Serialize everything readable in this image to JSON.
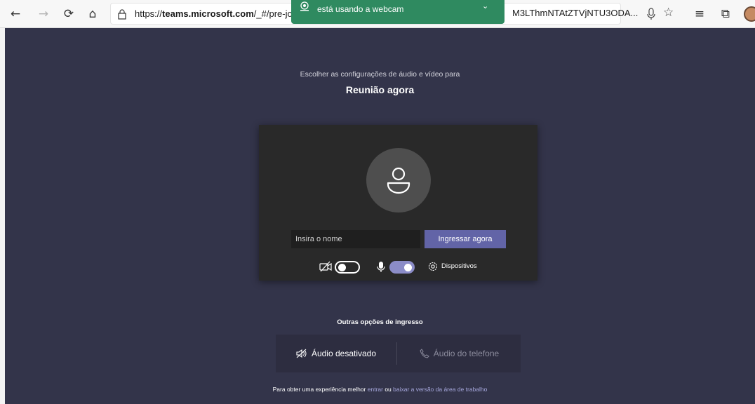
{
  "browser": {
    "url_left": "https://teams.microsoft.com/_#/pre-jo",
    "url_bold": "teams.microsoft.com",
    "url_right": "M3LThmNTAtZTVjNTU3ODA..."
  },
  "webcam_banner": {
    "message": "está usando a webcam"
  },
  "meeting": {
    "subtitle": "Escolher as configurações de áudio e vídeo para",
    "title": "Reunião agora"
  },
  "prejoin": {
    "name_placeholder": "Insira o nome",
    "join_label": "Ingressar agora",
    "camera_on": false,
    "mic_on": true,
    "devices_label": "Dispositivos"
  },
  "other_options": {
    "title": "Outras opções de ingresso",
    "audio_off_label": "Áudio desativado",
    "phone_label": "Áudio do telefone"
  },
  "footer": {
    "prefix": "Para obter uma experiência melhor ",
    "link_signin": "entrar",
    "middle": " ou ",
    "link_download": "baixar a versão da área de trabalho"
  },
  "colors": {
    "accent": "#6264a7",
    "background": "#33344a",
    "banner": "#2f8a60"
  }
}
